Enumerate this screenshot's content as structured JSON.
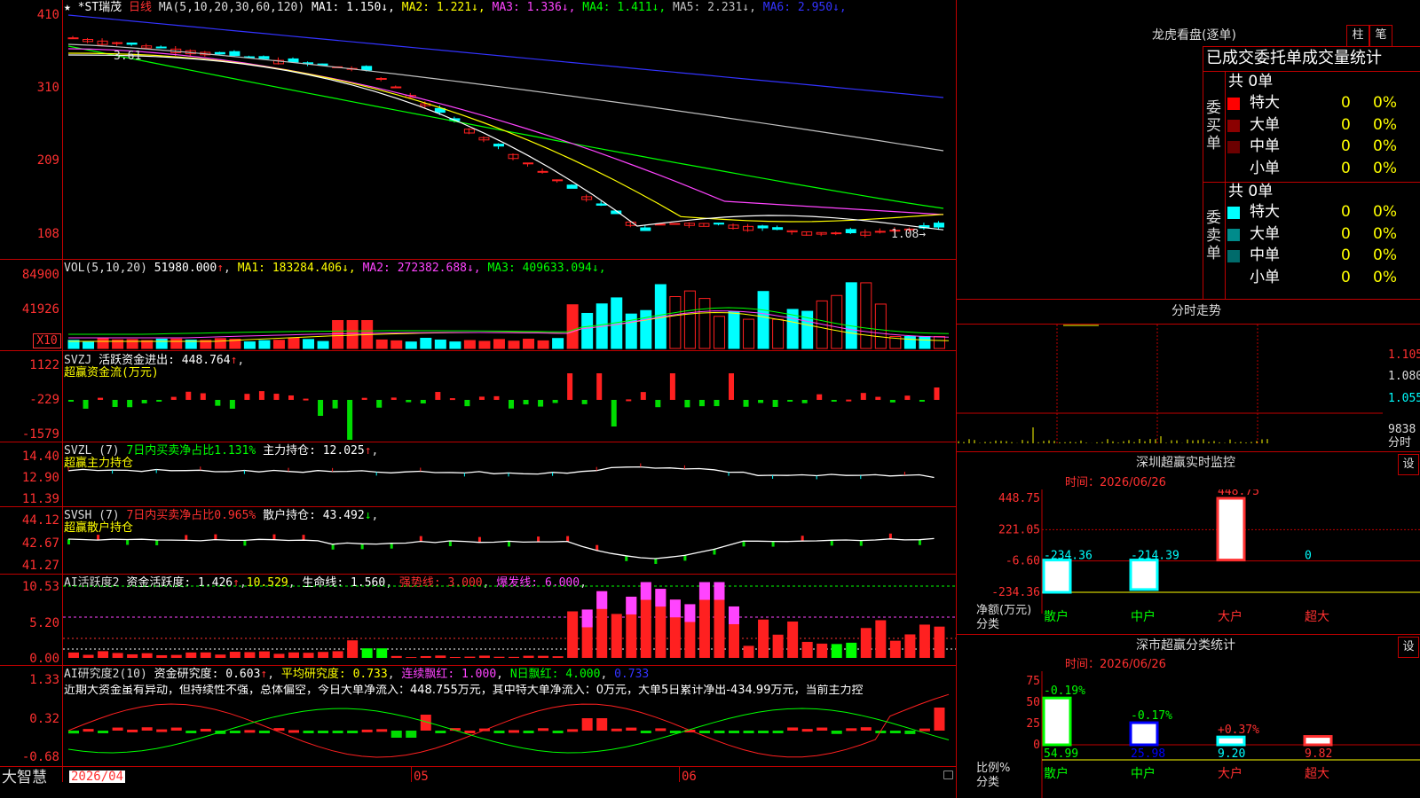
{
  "colors": {
    "up": "#ff2020",
    "down": "#00ffff",
    "bg": "#000000",
    "grid": "#c00000",
    "ma1": "#ffffff",
    "ma2": "#ffff00",
    "ma3": "#ff44ff",
    "ma4": "#00ff00",
    "ma5": "#c0c0c0",
    "ma6": "#3333ff"
  },
  "main": {
    "title_star": "★",
    "stock_name": "*ST瑞茂",
    "period": "日线",
    "ma_header": "MA(5,10,20,30,60,120)",
    "ma": [
      {
        "label": "MA1:",
        "value": "1.150",
        "arrow": "↓",
        "color": "#ffffff"
      },
      {
        "label": "MA2:",
        "value": "1.221",
        "arrow": "↓",
        "color": "#ffff00"
      },
      {
        "label": "MA3:",
        "value": "1.336",
        "arrow": "↓",
        "color": "#ff44ff"
      },
      {
        "label": "MA4:",
        "value": "1.411",
        "arrow": "↓",
        "color": "#00ff00"
      },
      {
        "label": "MA5:",
        "value": "2.231",
        "arrow": "↓",
        "color": "#c0c0c0"
      },
      {
        "label": "MA6:",
        "value": "2.950",
        "arrow": "↓",
        "color": "#3333ff"
      }
    ],
    "y_ticks": [
      "410",
      "310",
      "209",
      "108"
    ],
    "high_note": "3.61",
    "low_note": "1.08→"
  },
  "vol": {
    "header": "VOL(5,10,20)",
    "value": "51980.000",
    "arrow": "↑",
    "ma": [
      {
        "label": "MA1:",
        "value": "183284.406",
        "arrow": "↓",
        "color": "#ffff00"
      },
      {
        "label": "MA2:",
        "value": "272382.688",
        "arrow": "↓",
        "color": "#ff44ff"
      },
      {
        "label": "MA3:",
        "value": "409633.094",
        "arrow": "↓",
        "color": "#00ff00"
      }
    ],
    "y_ticks": [
      "84900",
      "41926"
    ],
    "unit": "X10"
  },
  "svzj": {
    "header": "SVZJ",
    "label": "活跃资金进出:",
    "value": "448.764",
    "arrow": "↑",
    "subtitle": "超赢资金流(万元)",
    "y_ticks": [
      "1122",
      "-229",
      "-1579"
    ]
  },
  "svzl": {
    "header": "SVZL (7)",
    "label1": "7日内买卖净占比1.131%",
    "label2": "主力持仓:",
    "value": "12.025",
    "arrow": "↑",
    "subtitle": "超赢主力持仓",
    "y_ticks": [
      "14.40",
      "12.90",
      "11.39"
    ]
  },
  "svsh": {
    "header": "SVSH (7)",
    "label1": "7日内买卖净占比0.965%",
    "label2": "散户持仓:",
    "value": "43.492",
    "arrow": "↓",
    "subtitle": "超赢散户持仓",
    "y_ticks": [
      "44.12",
      "42.67",
      "41.27"
    ]
  },
  "ai1": {
    "header": "AI活跃度2",
    "label": "资金活跃度:",
    "value": "1.426",
    "arrow": "↑",
    "v2": "10.529",
    "label3": "生命线:",
    "v3": "1.560",
    "label4": "强势线:",
    "v4": "3.000",
    "label5": "爆发线:",
    "v5": "6.000",
    "y_ticks": [
      "10.53",
      "5.20",
      "0.00"
    ]
  },
  "ai2": {
    "header": "AI研究度2(10)",
    "label": "资金研究度:",
    "value": "0.603",
    "arrow": "↑",
    "label2": "平均研究度:",
    "v2": "0.733",
    "label3": "连续飘红:",
    "v3": "1.000",
    "label4": "N日飘红:",
    "v4": "4.000",
    "v5": "0.733",
    "y_ticks": [
      "1.33",
      "0.32",
      "-0.68"
    ],
    "summary": "近期大资金虽有异动，但持续性不强，总体偏空，今日大单净流入：448.755万元，其中特大单净流入：0万元，大单5日累计净出-434.99万元，当前主力控"
  },
  "bottom": {
    "brand": "大智慧",
    "date_label": "2026/04",
    "months": [
      "05",
      "06"
    ]
  },
  "right": {
    "panel_title": "龙虎看盘(逐单)",
    "tab1": "柱",
    "tab2": "笔",
    "table_header": "已成交委托单成交量统计",
    "buy": {
      "side_label": "委买单",
      "total": "共 0单",
      "rows": [
        {
          "name": "特大",
          "qty": "0",
          "pct": "0%",
          "color": "#ff0000"
        },
        {
          "name": "大单",
          "qty": "0",
          "pct": "0%",
          "color": "#8b0000"
        },
        {
          "name": "中单",
          "qty": "0",
          "pct": "0%",
          "color": "#6b0000"
        },
        {
          "name": "小单",
          "qty": "0",
          "pct": "0%",
          "color": "#000000"
        }
      ]
    },
    "sell": {
      "side_label": "委卖单",
      "total": "共 0单",
      "rows": [
        {
          "name": "特大",
          "qty": "0",
          "pct": "0%",
          "color": "#00ffff"
        },
        {
          "name": "大单",
          "qty": "0",
          "pct": "0%",
          "color": "#008b8b"
        },
        {
          "name": "中单",
          "qty": "0",
          "pct": "0%",
          "color": "#006b6b"
        },
        {
          "name": "小单",
          "qty": "0",
          "pct": "0%",
          "color": "#000000"
        }
      ]
    },
    "intraday": {
      "title": "分时走势",
      "ticks": [
        "1.105",
        "1.080",
        "1.055"
      ],
      "vol_tick": "9838",
      "vol_unit": "分时"
    },
    "monitor": {
      "title": "深圳超赢实时监控",
      "settings": "设",
      "time_label": "时间：2026/06/26",
      "y_ticks": [
        "448.75",
        "221.05",
        "-6.60",
        "-234.36"
      ],
      "y_label": "净额(万元)",
      "x_label": "分类",
      "cats": [
        "散户",
        "中户",
        "大户",
        "超大"
      ],
      "values": [
        -234.36,
        -214.39,
        448.75,
        0
      ],
      "value_labels": [
        "-234.36",
        "-214.39",
        "448.75",
        "0"
      ]
    },
    "stats": {
      "title": "深市超赢分类统计",
      "settings": "设",
      "time_label": "时间：2026/06/26",
      "y_ticks": [
        "75",
        "50",
        "25",
        "0"
      ],
      "y_label": "比例%",
      "x_label": "分类",
      "cats": [
        "散户",
        "中户",
        "大户",
        "超大"
      ],
      "values": [
        54.99,
        25.98,
        9.2,
        9.82
      ],
      "value_labels": [
        "54.99",
        "25.98",
        "9.20",
        "9.82"
      ],
      "changes": [
        "-0.19%",
        "-0.17%",
        "+0.37%",
        ""
      ]
    }
  },
  "chart_data": [
    {
      "type": "candlestick",
      "title": "*ST瑞茂 日线",
      "y_ticks": [
        410,
        310,
        209,
        108
      ],
      "high_mark": 3.61,
      "low_mark": 1.08,
      "ma_values": {
        "MA1": 1.15,
        "MA2": 1.221,
        "MA3": 1.336,
        "MA4": 1.411,
        "MA5": 2.231,
        "MA6": 2.95
      }
    },
    {
      "type": "bar",
      "title": "VOL(5,10,20)",
      "last_value": 51980.0,
      "y_ticks": [
        84900,
        41926
      ]
    },
    {
      "type": "bar",
      "title": "SVZJ 超赢资金流(万元)",
      "last_value": 448.764,
      "y_ticks": [
        1122,
        -229,
        -1579
      ]
    },
    {
      "type": "line",
      "title": "SVZL 超赢主力持仓",
      "last_value": 12.025,
      "y_ticks": [
        14.4,
        12.9,
        11.39
      ]
    },
    {
      "type": "line",
      "title": "SVSH 超赢散户持仓",
      "last_value": 43.492,
      "y_ticks": [
        44.12,
        42.67,
        41.27
      ]
    },
    {
      "type": "bar",
      "title": "AI活跃度2",
      "last_value": 1.426,
      "y_ticks": [
        10.53,
        5.2,
        0.0
      ]
    },
    {
      "type": "bar",
      "title": "AI研究度2(10)",
      "last_value": 0.603,
      "y_ticks": [
        1.33,
        0.32,
        -0.68
      ]
    },
    {
      "type": "bar",
      "title": "深圳超赢实时监控",
      "categories": [
        "散户",
        "中户",
        "大户",
        "超大"
      ],
      "values": [
        -234.36,
        -214.39,
        448.75,
        0
      ],
      "ylabel": "净额(万元)",
      "xlabel": "分类"
    },
    {
      "type": "bar",
      "title": "深市超赢分类统计",
      "categories": [
        "散户",
        "中户",
        "大户",
        "超大"
      ],
      "values": [
        54.99,
        25.98,
        9.2,
        9.82
      ],
      "ylabel": "比例%",
      "xlabel": "分类"
    }
  ]
}
